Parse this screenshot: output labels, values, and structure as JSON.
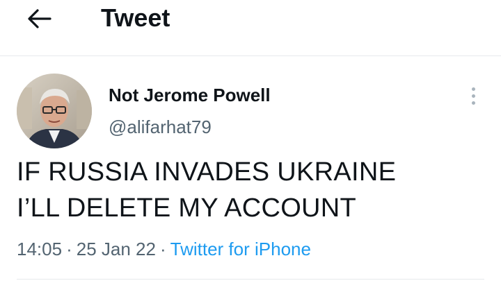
{
  "header": {
    "back_icon": "arrow-left-icon",
    "title": "Tweet"
  },
  "tweet": {
    "author": {
      "display_name": "Not Jerome Powell",
      "handle": "@alifarhat79",
      "avatar_icon": "avatar-photo"
    },
    "more_icon": "more-vertical-icon",
    "text_lines": [
      "IF RUSSIA INVADES UKRAINE",
      "I’LL DELETE MY ACCOUNT"
    ],
    "time": "14:05",
    "separator": "·",
    "date": "25 Jan 22",
    "source": "Twitter for iPhone"
  },
  "colors": {
    "text_primary": "#0f1419",
    "text_secondary": "#536471",
    "link": "#1d9bf0",
    "divider": "#e6e9ec"
  }
}
